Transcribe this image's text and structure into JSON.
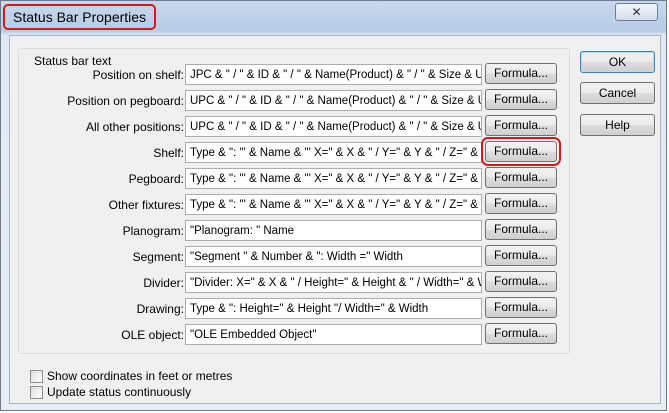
{
  "window": {
    "title": "Status Bar Properties",
    "close_label": "✕"
  },
  "group": {
    "legend": "Status bar text"
  },
  "rows": [
    {
      "label": "Position on shelf:",
      "value": "JPC & \" / \" & ID & \" / \" & Name(Product) & \" / \" & Size & UOM",
      "button": "Formula..."
    },
    {
      "label": "Position on pegboard:",
      "value": "UPC & \" / \" & ID & \" / \" & Name(Product)  & \" / \" & Size & UOM",
      "button": "Formula..."
    },
    {
      "label": "All other positions:",
      "value": "UPC & \" / \" & ID & \" / \" & Name(Product) & \" / \" & Size & UOM",
      "button": "Formula..."
    },
    {
      "label": "Shelf:",
      "value": "Type & \": '\" & Name & \"'  X=\" & X & \" / Y=\" & Y & \" / Z=\" & Z &",
      "button": "Formula..."
    },
    {
      "label": "Pegboard:",
      "value": "Type & \": '\" & Name & \"'  X=\" & X & \" / Y=\" & Y & \" / Z=\" & Z &",
      "button": "Formula..."
    },
    {
      "label": "Other fixtures:",
      "value": "Type & \": '\" & Name & \"'  X=\" & X & \" / Y=\" & Y & \" / Z=\" & Z &",
      "button": "Formula..."
    },
    {
      "label": "Planogram:",
      "value": "\"Planogram: \" Name",
      "button": "Formula..."
    },
    {
      "label": "Segment:",
      "value": "\"Segment \" & Number & \":  Width =\" Width",
      "button": "Formula..."
    },
    {
      "label": "Divider:",
      "value": "\"Divider:  X=\" & X & \" / Height=\" & Height & \" / Width=\" & Wi",
      "button": "Formula..."
    },
    {
      "label": "Drawing:",
      "value": "Type & \":  Height=\" & Height \"/ Width=\" & Width",
      "button": "Formula..."
    },
    {
      "label": "OLE object:",
      "value": "\"OLE Embedded Object\"",
      "button": "Formula..."
    }
  ],
  "buttons": {
    "ok": "OK",
    "cancel": "Cancel",
    "help": "Help"
  },
  "checkboxes": {
    "show_coords": "Show coordinates in feet or metres",
    "update_status": "Update status continuously"
  }
}
